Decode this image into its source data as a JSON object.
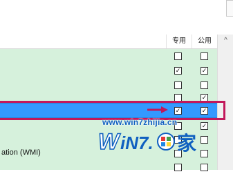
{
  "header": {
    "col_private": "专用",
    "col_public": "公用"
  },
  "rows": [
    {
      "name": "",
      "private": false,
      "public": false
    },
    {
      "name": "",
      "private": true,
      "public": true
    },
    {
      "name": "",
      "private": false,
      "public": false
    },
    {
      "name": "",
      "private": false,
      "public": true
    },
    {
      "name": "",
      "private": true,
      "public": true,
      "selected": true
    },
    {
      "name": "",
      "private": false,
      "public": true
    },
    {
      "name": "",
      "private": false,
      "public": false
    },
    {
      "name": "ation (WMI)",
      "private": false,
      "public": false
    },
    {
      "name": "",
      "private": false,
      "public": false
    }
  ],
  "check_glyph": "✓",
  "scrollbar": {
    "up_arrow": "^"
  },
  "watermark": {
    "url": "www.win7zhijia.cn",
    "logo_text_1": "W",
    "logo_text_2": "iN7.",
    "logo_text_3": "家"
  },
  "colors": {
    "row_bg": "#d6f1dc",
    "selected_bg": "#3399ff",
    "highlight_border": "#c2185b",
    "watermark_blue": "#1060c0"
  }
}
